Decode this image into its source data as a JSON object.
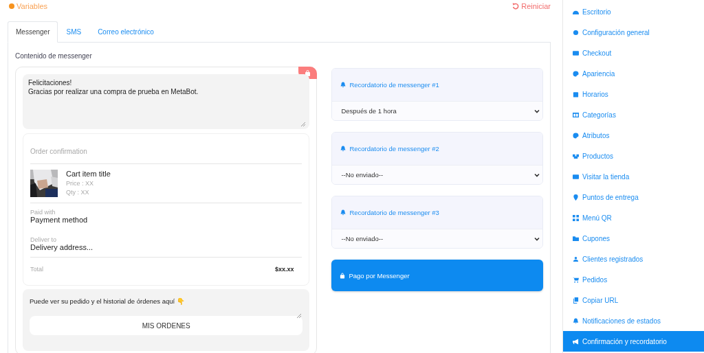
{
  "header": {
    "variables": "Variables",
    "reset": "Reiniciar"
  },
  "tabs": [
    {
      "label": "Messenger",
      "selected": true
    },
    {
      "label": "SMS",
      "selected": false
    },
    {
      "label": "Correo electrónico",
      "selected": false
    }
  ],
  "section_title": "Contenido de messenger",
  "message": {
    "text": "Felicitaciones!\nGracias por realizar una compra de prueba en MetaBot."
  },
  "order": {
    "title": "Order confirmation",
    "item_title": "Cart item title",
    "price": "Price : XX",
    "qty": "Qty : XX",
    "paid_label": "Paid with",
    "paid_value": "Payment method",
    "deliver_label": "Deliver to",
    "deliver_value": "Delivery address...",
    "total_label": "Total",
    "total_value": "$xx.xx"
  },
  "footer_message": {
    "text": "Puede ver su pedido y el historial de órdenes aquí 👇",
    "button": "MIS ORDENES"
  },
  "reminders": [
    {
      "title": "Recordatorio de messenger #1",
      "value": "Después de 1 hora"
    },
    {
      "title": "Recordatorio de messenger #2",
      "value": "--No enviado--"
    },
    {
      "title": "Recordatorio de messenger #3",
      "value": "--No enviado--"
    }
  ],
  "pay_button": "Pago por Messenger",
  "sidebar": {
    "items": [
      {
        "label": "Escritorio",
        "selected": false
      },
      {
        "label": "Configuración general",
        "selected": false
      },
      {
        "label": "Checkout",
        "selected": false
      },
      {
        "label": "Apariencia",
        "selected": false
      },
      {
        "label": "Horarios",
        "selected": false
      },
      {
        "label": "Categorías",
        "selected": false
      },
      {
        "label": "Atributos",
        "selected": false
      },
      {
        "label": "Productos",
        "selected": false
      },
      {
        "label": "Visitar la tienda",
        "selected": false
      },
      {
        "label": "Puntos de entrega",
        "selected": false
      },
      {
        "label": "Menú QR",
        "selected": false
      },
      {
        "label": "Cupones",
        "selected": false
      },
      {
        "label": "Clientes registrados",
        "selected": false
      },
      {
        "label": "Pedidos",
        "selected": false
      },
      {
        "label": "Copiar URL",
        "selected": false
      },
      {
        "label": "Notificaciones de estados",
        "selected": false
      },
      {
        "label": "Confirmación y recordatorio",
        "selected": true
      }
    ]
  }
}
